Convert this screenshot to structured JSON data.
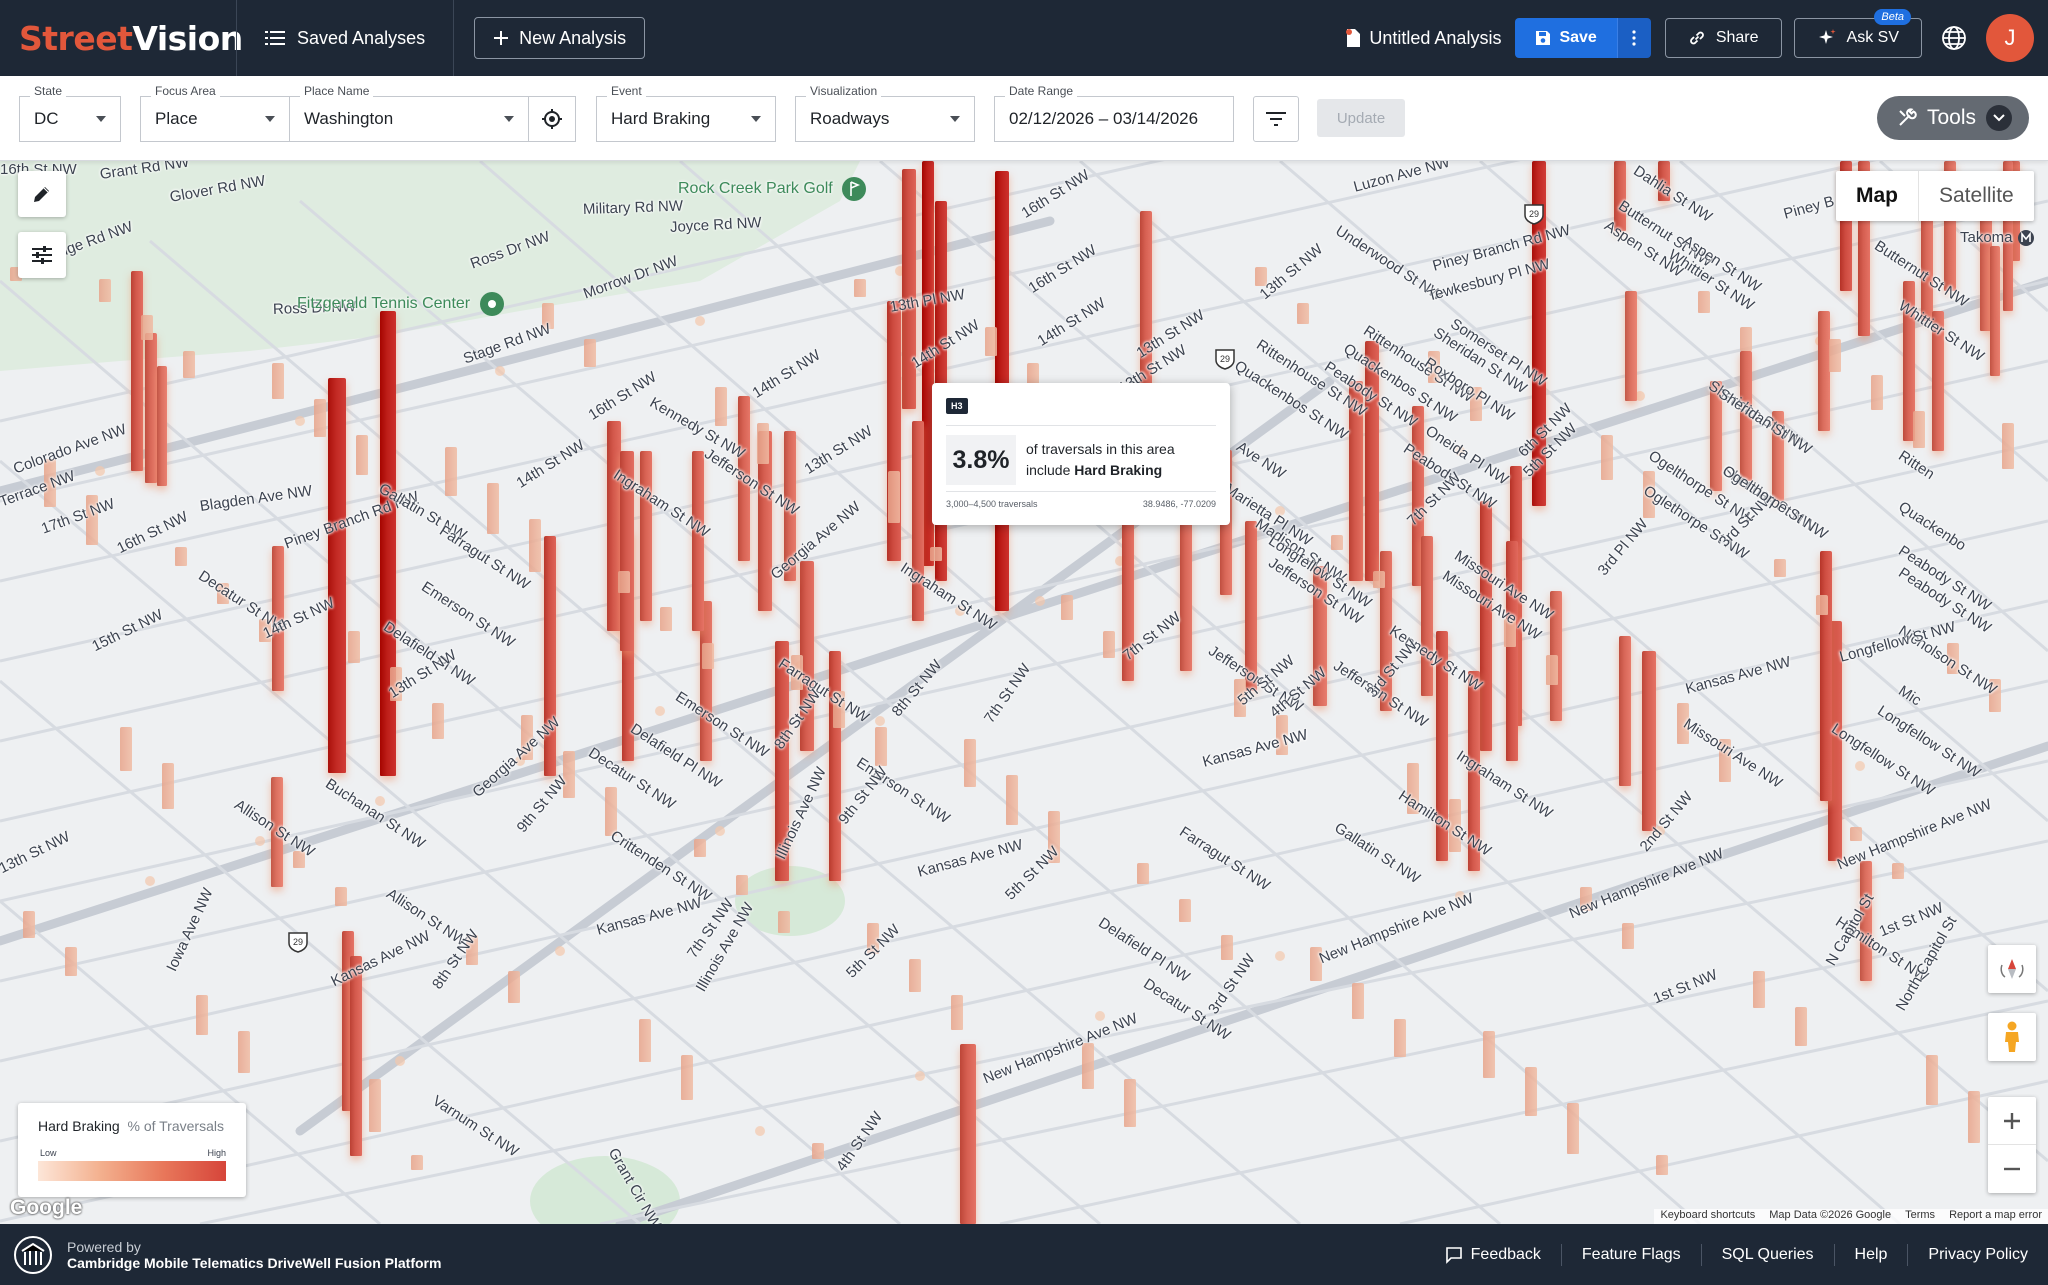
{
  "app": {
    "logo_part1": "Street",
    "logo_part2": "Vision",
    "saved_analyses": "Saved Analyses",
    "new_analysis": "New Analysis",
    "analysis_title": "Untitled Analysis",
    "save": "Save",
    "share": "Share",
    "ask_sv": "Ask SV",
    "beta": "Beta",
    "avatar_initial": "J",
    "accent_color": "#e2573b",
    "header_bg": "#1e2836",
    "save_color": "#1f6fe0"
  },
  "filters": {
    "state": {
      "label": "State",
      "value": "DC"
    },
    "focus_area": {
      "label": "Focus Area",
      "value": "Place"
    },
    "place_name": {
      "label": "Place Name",
      "value": "Washington"
    },
    "event": {
      "label": "Event",
      "value": "Hard Braking"
    },
    "visualization": {
      "label": "Visualization",
      "value": "Roadways"
    },
    "date_range": {
      "label": "Date Range",
      "value": "02/12/2026 – 03/14/2026"
    },
    "update": "Update",
    "tools": "Tools"
  },
  "map": {
    "map_toggle": "Map",
    "satellite_toggle": "Satellite",
    "tooltip": {
      "badge": "H3",
      "percent": "3.8%",
      "line1": "of traversals in this area",
      "line2_prefix": "include ",
      "line2_event": "Hard Braking",
      "traversals": "3,000–4,500 traversals",
      "coords": "38.9486, -77.0209"
    },
    "legend": {
      "title": "Hard Braking",
      "subtitle": "% of Traversals",
      "low": "Low",
      "high": "High"
    },
    "attribution": {
      "google": "Google",
      "keyboard": "Keyboard shortcuts",
      "map_data": "Map Data ©2026 Google",
      "terms": "Terms",
      "report": "Report a map error"
    },
    "parks": {
      "rock_creek": "Rock Creek Park Golf",
      "fitzgerald": "Fitzgerald Tennis Center",
      "takoma": "Takoma"
    },
    "route_29": "29",
    "streets": [
      "Grant Rd NW",
      "Glover Rd NW",
      "Military Rd NW",
      "Joyce Rd NW",
      "Ridge Rd NW",
      "Ross Dr NW",
      "Ross Dr NW",
      "Morrow Dr NW",
      "16th St NW",
      "Stage Rd NW",
      "Colorado Ave NW",
      "Terrace NW",
      "Blagden Ave NW",
      "17th St NW",
      "16th St NW",
      "Decatur St NW",
      "Piney Branch Rd NW",
      "Gallatin St NW",
      "14th St NW",
      "Kennedy St NW",
      "Jefferson St NW",
      "Ingraham St NW",
      "13th St NW",
      "14th St NW",
      "16th St NW",
      "13th Pl NW",
      "13th St NW",
      "14th St NW",
      "16th St NW",
      "Farragut St NW",
      "Emerson St NW",
      "Delafield Pl NW",
      "14th St NW",
      "15th St NW",
      "13th St NW",
      "Georgia Ave NW",
      "Ingraham St NW",
      "Buchanan St NW",
      "Allison St NW",
      "Georgia Ave NW",
      "Decatur St NW",
      "Delafield Pl NW",
      "Emerson St NW",
      "Farragut St NW",
      "9th St NW",
      "Crittenden St NW",
      "8th St NW",
      "8th St NW",
      "Emerson St NW",
      "7th St NW",
      "Kansas Ave NW",
      "Illinois Ave NW",
      "9th St NW",
      "Allison St NW",
      "Iowa Ave NW",
      "13th St NW",
      "Kansas Ave NW",
      "8th St NW",
      "Kansas Ave NW",
      "Kansas Ave NW",
      "7th St NW",
      "Illinois Ave NW",
      "5th St NW",
      "5th St NW",
      "Varnum St NW",
      "Grant Cir NW",
      "4th St NW",
      "New Hampshire Ave NW",
      "Farragut St NW",
      "Delafield Pl NW",
      "Decatur St NW",
      "Kansas Ave NW",
      "Gallatin St NW",
      "Hamilton St NW",
      "Ingraham St NW",
      "3rd St NW",
      "New Hampshire Ave NW",
      "New Hampshire Ave NW",
      "New Hampshire Ave NW",
      "1st St NW",
      "2nd St NW",
      "1st St NW",
      "Hamilton St NW",
      "Longfellow St NW",
      "Kansas Ave NW",
      "Missouri Ave NW",
      "Longfellow St NW",
      "Nicholson St NW",
      "Jefferson St NW",
      "Kennedy St NW",
      "Jefferson St NW",
      "7th St NW",
      "5th St NW",
      "4th St NW",
      "3rd St NW",
      "Missouri Ave NW",
      "Oglethorpe St NW",
      "Peabody St NW",
      "Oneida Pl NW",
      "Peabody St NW",
      "Sheridan St NW",
      "Quackenbos St NW",
      "Rittenhouse St NW",
      "Ogelthorpe St NW",
      "3rd St NW",
      "3rd Pl NW",
      "Missouri Ave NW",
      "Madison St NW",
      "Longfellow St NW",
      "Jefferson St NW",
      "Ave NW",
      "Marietta Pl NW",
      "Luzon Ave NW",
      "Dahlia St NW",
      "Butternut St NW",
      "Aspen St NW",
      "Underwood St NW",
      "13th St NW",
      "Piney Branch Rd NW",
      "Sheridan St NW",
      "Rittenhouse St NW",
      "Quackenbos St NW",
      "Peabody St NW",
      "Tewkesbury Pl NW",
      "Somerset Pl NW",
      "Roxboro Pl NW",
      "Sheridan St NW",
      "Whittier St NW",
      "Aspen St NW",
      "Piney B",
      "Butternut St NW",
      "Whittier St NW",
      "16th St NW",
      "14th St NW",
      "13th St NW",
      "7th St NW",
      "6th St NW",
      "5th St NW",
      "Ritten",
      "Quackenbo",
      "Peabody St NW",
      "Sheridan St NW",
      "North Capitol St",
      "N Capitol St",
      "Mic",
      "Ogelthorpe St NW",
      "Longfellow St NW"
    ]
  },
  "footer": {
    "powered_by": "Powered by",
    "platform": "Cambridge Mobile Telematics DriveWell Fusion Platform",
    "feedback": "Feedback",
    "feature_flags": "Feature Flags",
    "sql_queries": "SQL Queries",
    "help": "Help",
    "privacy": "Privacy Policy"
  }
}
